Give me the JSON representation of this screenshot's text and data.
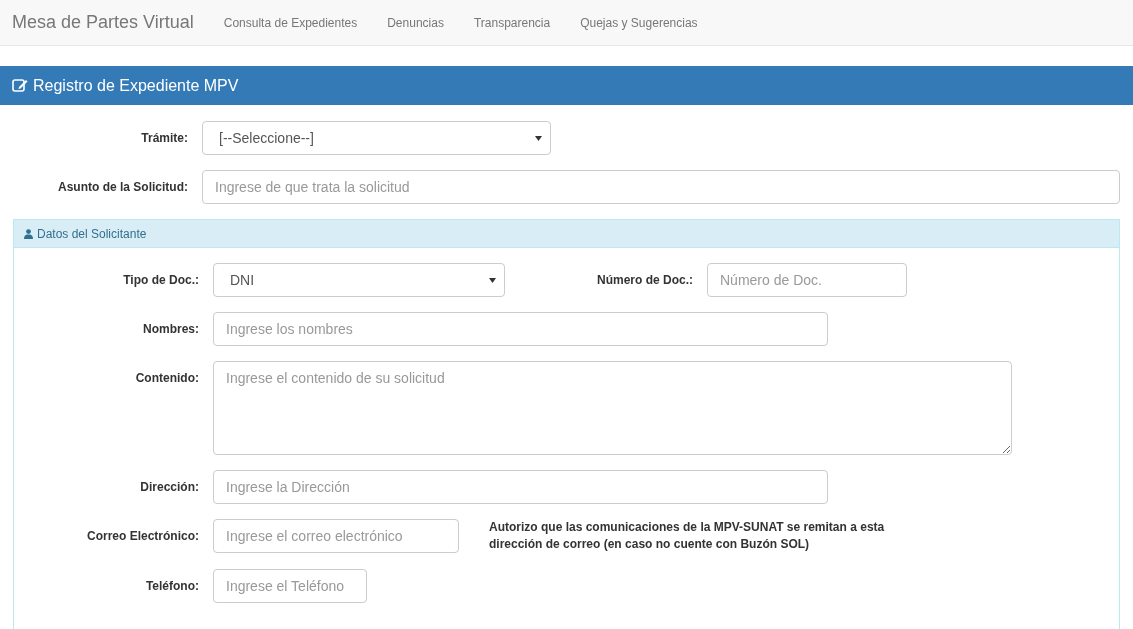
{
  "navbar": {
    "brand": "Mesa de Partes Virtual",
    "links": [
      "Consulta de Expedientes",
      "Denuncias",
      "Transparencia",
      "Quejas y Sugerencias"
    ]
  },
  "panel": {
    "title": "Registro de Expediente MPV",
    "fields": [
      {
        "label": "Trámite:",
        "kind": "select",
        "value": "[--Seleccione--]"
      },
      {
        "label": "Asunto de la Solicitud:",
        "kind": "input",
        "placeholder": "Ingrese de que trata la solicitud"
      }
    ]
  },
  "section": {
    "title": "Datos del Solicitante",
    "rows": [
      [
        {
          "label": "Tipo de Doc.:",
          "kind": "select",
          "value": "DNI"
        },
        {
          "label": "Número de Doc.:",
          "kind": "input",
          "placeholder": "Número de Doc."
        }
      ],
      [
        {
          "label": "Nombres:",
          "kind": "input",
          "placeholder": "Ingrese los nombres"
        }
      ],
      [
        {
          "label": "Contenido:",
          "kind": "textarea",
          "placeholder": "Ingrese el contenido de su solicitud"
        }
      ],
      [
        {
          "label": "Dirección:",
          "kind": "input",
          "placeholder": "Ingrese la Dirección"
        }
      ],
      [
        {
          "label": "Correo Electrónico:",
          "kind": "input",
          "placeholder": "Ingrese el correo electrónico",
          "note": "Autorizo que las comunicaciones de la MPV-SUNAT se remitan a esta dirección de correo (en caso no cuente con Buzón SOL)"
        }
      ],
      [
        {
          "label": "Teléfono:",
          "kind": "input",
          "placeholder": "Ingrese el Teléfono"
        }
      ]
    ]
  }
}
